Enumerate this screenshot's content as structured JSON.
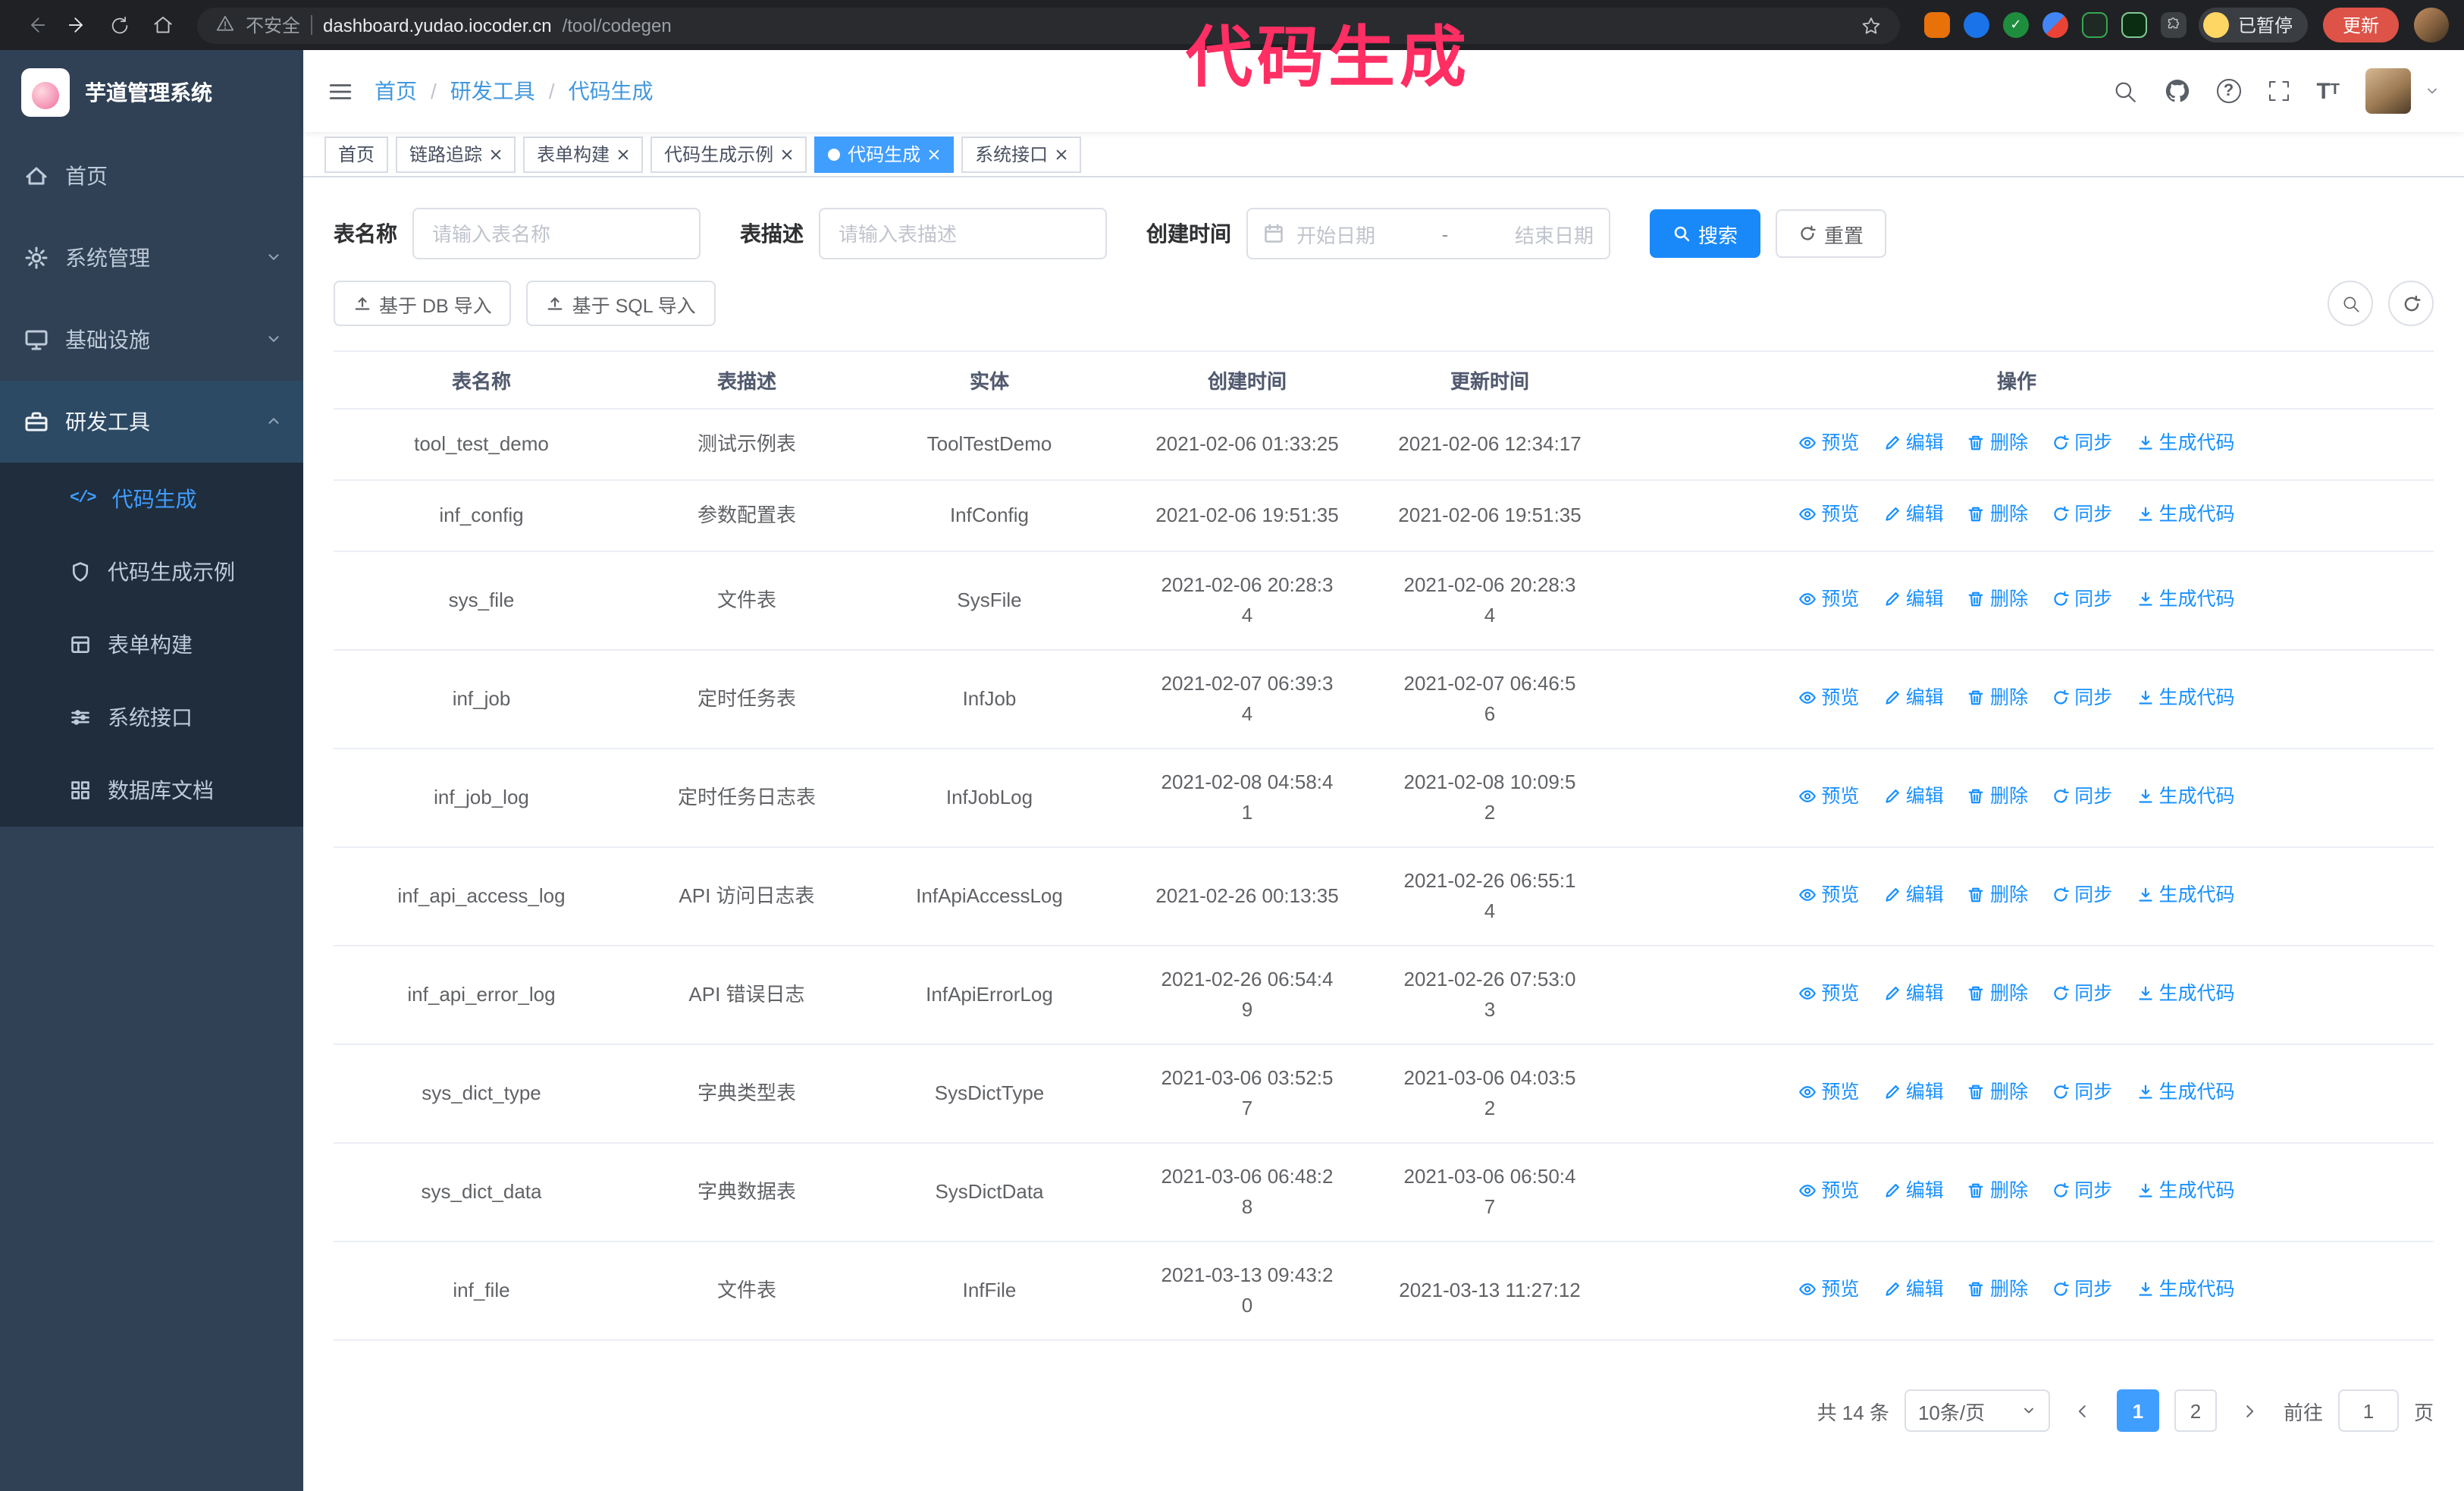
{
  "annotation": {
    "text": "代码生成",
    "color": "#ff2e63"
  },
  "browser": {
    "security_label": "不安全",
    "url_host": "dashboard.yudao.iocoder.cn",
    "url_path": "/tool/codegen",
    "paused_badge": "已暂停",
    "update_button": "更新",
    "nav_icons": [
      "back",
      "forward",
      "refresh",
      "home"
    ],
    "extension_icons": [
      "extension-1",
      "extension-2",
      "extension-3",
      "extension-4",
      "extension-5",
      "extension-6",
      "extensions-menu-puzzle"
    ]
  },
  "sidebar": {
    "logo_title": "芋道管理系统",
    "items": [
      {
        "label": "首页",
        "icon": "dashboard-icon"
      },
      {
        "label": "系统管理",
        "icon": "gear-icon",
        "chevron": "down"
      },
      {
        "label": "基础设施",
        "icon": "monitor-icon",
        "chevron": "down"
      },
      {
        "label": "研发工具",
        "icon": "toolbox-icon",
        "chevron": "up",
        "expanded": true
      }
    ],
    "submenu": [
      {
        "label": "代码生成",
        "icon": "code-icon",
        "active": true
      },
      {
        "label": "代码生成示例",
        "icon": "shield-icon"
      },
      {
        "label": "表单构建",
        "icon": "form-icon"
      },
      {
        "label": "系统接口",
        "icon": "sliders-icon"
      },
      {
        "label": "数据库文档",
        "icon": "grid-icon"
      }
    ]
  },
  "header": {
    "breadcrumb": [
      {
        "label": "首页"
      },
      {
        "label": "研发工具"
      },
      {
        "label": "代码生成"
      }
    ],
    "breadcrumb_separator": "/",
    "right_icons": [
      "search-icon",
      "github-icon",
      "help-icon",
      "fullscreen-icon",
      "font-size-icon",
      "user-avatar",
      "caret-down-icon"
    ]
  },
  "tabs": [
    {
      "label": "首页",
      "closable": false,
      "active": false
    },
    {
      "label": "链路追踪",
      "closable": true,
      "active": false
    },
    {
      "label": "表单构建",
      "closable": true,
      "active": false
    },
    {
      "label": "代码生成示例",
      "closable": true,
      "active": false
    },
    {
      "label": "代码生成",
      "closable": true,
      "active": true
    },
    {
      "label": "系统接口",
      "closable": true,
      "active": false
    }
  ],
  "filters": {
    "table_name_label": "表名称",
    "table_name_placeholder": "请输入表名称",
    "table_desc_label": "表描述",
    "table_desc_placeholder": "请输入表描述",
    "create_time_label": "创建时间",
    "date_start_placeholder": "开始日期",
    "date_separator": "-",
    "date_end_placeholder": "结束日期",
    "search_button": "搜索",
    "reset_button": "重置"
  },
  "toolbar": {
    "import_db_button": "基于 DB 导入",
    "import_sql_button": "基于 SQL 导入"
  },
  "table": {
    "columns": [
      "表名称",
      "表描述",
      "实体",
      "创建时间",
      "更新时间",
      "操作"
    ],
    "actions": [
      "预览",
      "编辑",
      "删除",
      "同步",
      "生成代码"
    ],
    "rows": [
      {
        "name": "tool_test_demo",
        "desc": "测试示例表",
        "entity": "ToolTestDemo",
        "create_time": "2021-02-06 01:33:25",
        "update_time": "2021-02-06 12:34:17",
        "create_time_two_line": false,
        "update_time_two_line": false
      },
      {
        "name": "inf_config",
        "desc": "参数配置表",
        "entity": "InfConfig",
        "create_time": "2021-02-06 19:51:35",
        "update_time": "2021-02-06 19:51:35",
        "create_time_two_line": false,
        "update_time_two_line": false
      },
      {
        "name": "sys_file",
        "desc": "文件表",
        "entity": "SysFile",
        "create_time": "2021-02-06 20:28:34",
        "update_time": "2021-02-06 20:28:34",
        "create_time_two_line": true,
        "update_time_two_line": true
      },
      {
        "name": "inf_job",
        "desc": "定时任务表",
        "entity": "InfJob",
        "create_time": "2021-02-07 06:39:34",
        "update_time": "2021-02-07 06:46:56",
        "create_time_two_line": true,
        "update_time_two_line": true
      },
      {
        "name": "inf_job_log",
        "desc": "定时任务日志表",
        "entity": "InfJobLog",
        "create_time": "2021-02-08 04:58:41",
        "update_time": "2021-02-08 10:09:52",
        "create_time_two_line": true,
        "update_time_two_line": true
      },
      {
        "name": "inf_api_access_log",
        "desc": "API 访问日志表",
        "entity": "InfApiAccessLog",
        "create_time": "2021-02-26 00:13:35",
        "update_time": "2021-02-26 06:55:14",
        "create_time_two_line": false,
        "update_time_two_line": true
      },
      {
        "name": "inf_api_error_log",
        "desc": "API 错误日志",
        "entity": "InfApiErrorLog",
        "create_time": "2021-02-26 06:54:49",
        "update_time": "2021-02-26 07:53:03",
        "create_time_two_line": true,
        "update_time_two_line": true
      },
      {
        "name": "sys_dict_type",
        "desc": "字典类型表",
        "entity": "SysDictType",
        "create_time": "2021-03-06 03:52:57",
        "update_time": "2021-03-06 04:03:52",
        "create_time_two_line": true,
        "update_time_two_line": true
      },
      {
        "name": "sys_dict_data",
        "desc": "字典数据表",
        "entity": "SysDictData",
        "create_time": "2021-03-06 06:48:28",
        "update_time": "2021-03-06 06:50:47",
        "create_time_two_line": true,
        "update_time_two_line": true
      },
      {
        "name": "inf_file",
        "desc": "文件表",
        "entity": "InfFile",
        "create_time": "2021-03-13 09:43:20",
        "update_time": "2021-03-13 11:27:12",
        "create_time_two_line": true,
        "update_time_two_line": false
      }
    ]
  },
  "pagination": {
    "total": "共 14 条",
    "page_size": "10条/页",
    "pages": [
      "1",
      "2"
    ],
    "active_page": "1",
    "goto_label": "前往",
    "goto_value": "1",
    "goto_suffix": "页"
  }
}
